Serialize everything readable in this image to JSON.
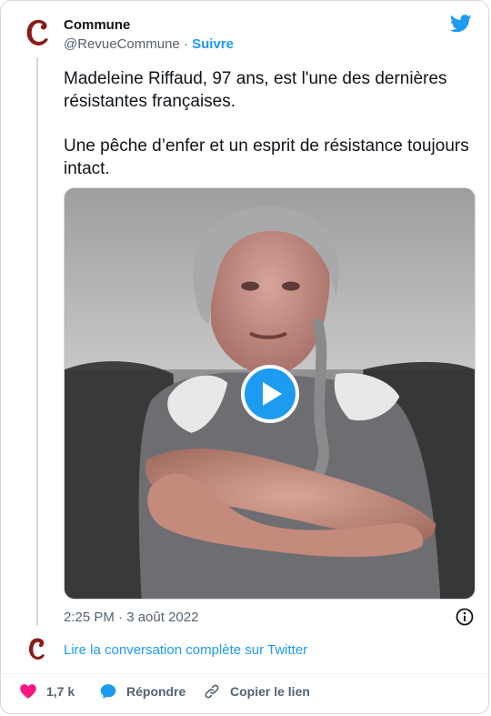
{
  "account": {
    "display_name": "Commune",
    "handle": "@RevueCommune",
    "separator": " · ",
    "follow_label": "Suivre",
    "avatar_letter": "c"
  },
  "tweet": {
    "paragraphs": [
      "Madeleine Riffaud, 97 ans, est l'une des dernières résistantes françaises.",
      "Une pêche d’enfer et un esprit de résistance toujours intact."
    ],
    "timestamp": "2:25 PM · 3 août 2022"
  },
  "conversation_link": "Lire la conversation complète sur Twitter",
  "actions": {
    "like_count": "1,7 k",
    "reply_label": "Répondre",
    "copy_label": "Copier le lien"
  },
  "icons": {
    "brand": "twitter-bird-icon",
    "play": "play-icon",
    "info": "info-icon",
    "like": "heart-icon",
    "reply": "speech-bubble-icon",
    "copy": "link-icon"
  },
  "colors": {
    "accent": "#1d9bf0",
    "like": "#f91880",
    "brand_avatar": "#8b1a1a",
    "text": "#0f1419",
    "secondary": "#536471"
  }
}
